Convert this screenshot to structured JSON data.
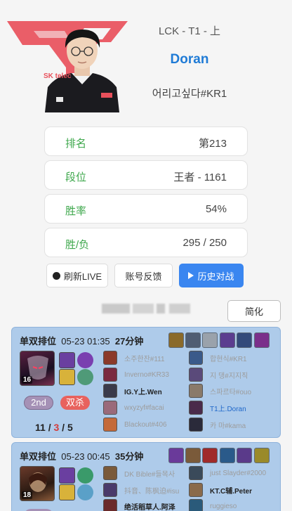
{
  "profile": {
    "league_line": "LCK - T1 - 上",
    "player_name": "Doran",
    "account_id": "어리고싶다#KR1",
    "sponsor_text": "SK telec"
  },
  "stats": [
    {
      "label": "排名",
      "value": "第213"
    },
    {
      "label": "段位",
      "value": "王者 - 1161"
    },
    {
      "label": "胜率",
      "value": "54%"
    },
    {
      "label": "胜/负",
      "value": "295 / 250"
    }
  ],
  "actions": {
    "refresh_label": "刷新LIVE",
    "feedback_label": "账号反馈",
    "history_label": "历史对战",
    "simplify_label": "简化"
  },
  "matches": [
    {
      "queue": "单双排位",
      "date": "05-23",
      "time": "01:35",
      "duration": "27分钟",
      "champion_level": "16",
      "placement": "2nd",
      "multikill": "双杀",
      "kda": {
        "kills": "11",
        "deaths": "3",
        "assists": "5"
      },
      "team_left": [
        "소주한잔#111",
        "Inverno#KR33",
        "IG.Y上.Wen",
        "wxyzyf#facai",
        "Blackout#406"
      ],
      "team_right": [
        "합현식#KR1",
        "지 댕#지지직",
        "스파르타#ouo",
        "T1上.Doran",
        "카 마#kama"
      ]
    },
    {
      "queue": "单双排位",
      "date": "05-23",
      "time": "00:45",
      "duration": "35分钟",
      "champion_level": "18",
      "team_left": [
        "DK Bible#들목사",
        "抖音、陈枫迫#isu",
        "绝活稻草人.阿泽"
      ],
      "team_right": [
        "just Slayder#2000",
        "KT.C辅.Peter",
        "ruggieso"
      ]
    }
  ],
  "colors": {
    "accent_blue": "#1f7bd6",
    "stat_label_green": "#3fa84d",
    "primary_button": "#3a86f0",
    "card_background": "#aecbea",
    "deaths_red": "#d23b3b",
    "logo_red": "#e8505b"
  },
  "icons": {
    "refresh": "record-dot-icon",
    "history": "play-icon"
  }
}
